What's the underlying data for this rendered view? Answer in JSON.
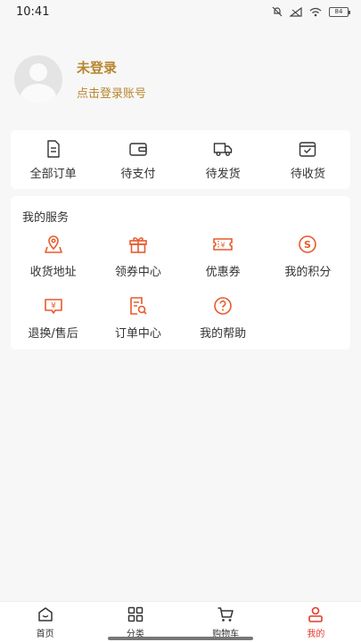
{
  "status_bar": {
    "time": "10:41",
    "battery": "84"
  },
  "profile": {
    "name": "未登录",
    "hint": "点击登录账号"
  },
  "orders": [
    {
      "label": "全部订单",
      "icon": "document-icon"
    },
    {
      "label": "待支付",
      "icon": "wallet-icon"
    },
    {
      "label": "待发货",
      "icon": "truck-icon"
    },
    {
      "label": "待收货",
      "icon": "box-check-icon"
    }
  ],
  "services": {
    "title": "我的服务",
    "items": [
      {
        "label": "收货地址",
        "icon": "location-icon"
      },
      {
        "label": "领券中心",
        "icon": "gift-icon"
      },
      {
        "label": "优惠券",
        "icon": "coupon-icon"
      },
      {
        "label": "我的积分",
        "icon": "points-icon"
      },
      {
        "label": "退换/售后",
        "icon": "refund-icon"
      },
      {
        "label": "订单中心",
        "icon": "order-search-icon"
      },
      {
        "label": "我的帮助",
        "icon": "help-icon"
      }
    ]
  },
  "tabbar": [
    {
      "label": "首页",
      "icon": "home-icon"
    },
    {
      "label": "分类",
      "icon": "category-icon"
    },
    {
      "label": "购物车",
      "icon": "cart-icon"
    },
    {
      "label": "我的",
      "icon": "user-icon"
    }
  ],
  "colors": {
    "accent": "#e85a2c",
    "brand_text": "#b8862e",
    "tab_active": "#e23b2a"
  }
}
